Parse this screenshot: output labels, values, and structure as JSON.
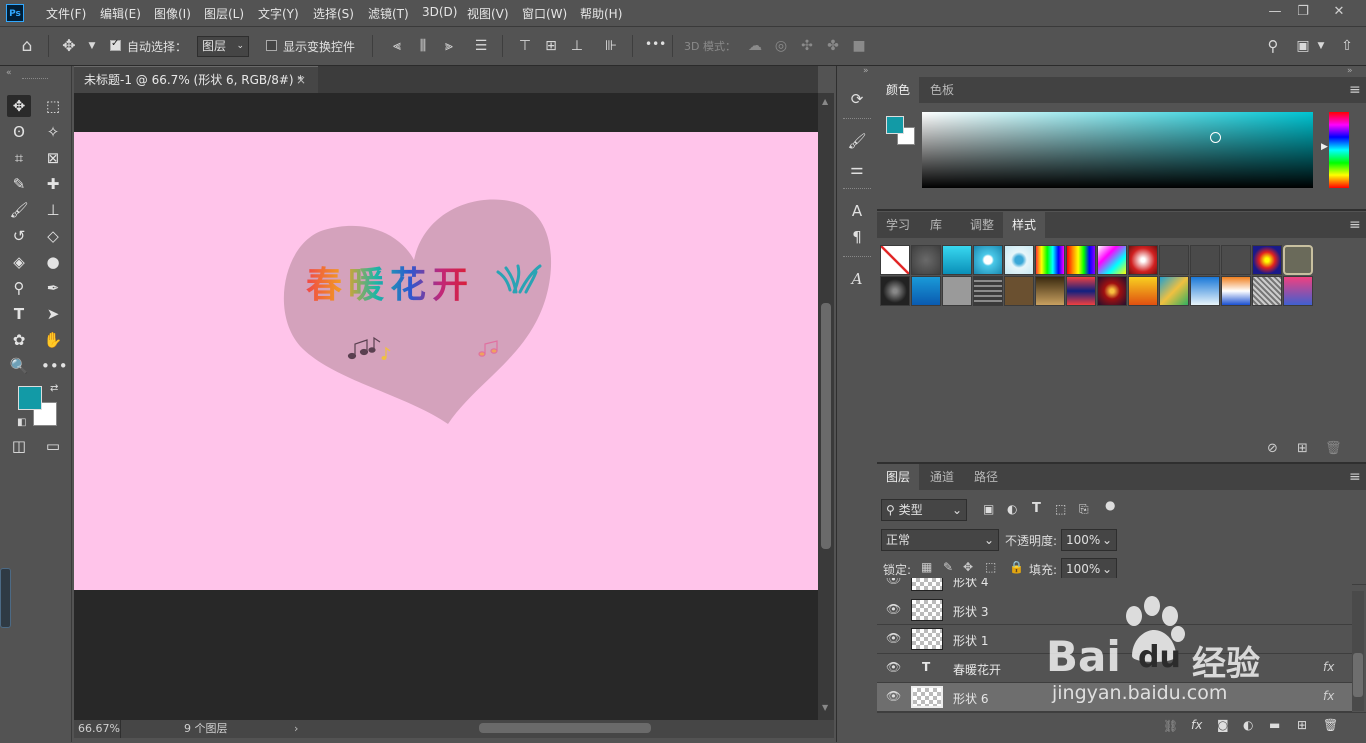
{
  "app": {
    "logo": "Ps"
  },
  "menu": [
    "文件(F)",
    "编辑(E)",
    "图像(I)",
    "图层(L)",
    "文字(Y)",
    "选择(S)",
    "滤镜(T)",
    "3D(D)",
    "视图(V)",
    "窗口(W)",
    "帮助(H)"
  ],
  "window_controls": {
    "minimize": "—",
    "restore": "❐",
    "close": "✕"
  },
  "options": {
    "auto_select_label": "自动选择：",
    "auto_select_checked": true,
    "auto_select_target": "图层",
    "show_transform_label": "显示变换控件",
    "show_transform_checked": false,
    "more": "•••",
    "mode_3d_label": "3D 模式："
  },
  "document": {
    "tab_title": "未标题-1 @ 66.7% (形状 6, RGB/8#) *",
    "tab_close": "×",
    "canvas_text": "春暖花开",
    "zoom": "66.67%",
    "layer_count": "9 个图层",
    "canvas_color": "#ffc4ea",
    "heart_color": "#d4a2bc"
  },
  "colors": {
    "foreground": "#129aa6",
    "background": "#ffffff"
  },
  "color_panel": {
    "tabs": [
      "颜色",
      "色板"
    ],
    "active": 0
  },
  "styles_panel": {
    "tabs": [
      "学习",
      "库",
      "调整",
      "样式"
    ],
    "active": 3
  },
  "layers_panel": {
    "tabs": [
      "图层",
      "通道",
      "路径"
    ],
    "active": 0,
    "filter_kind": "类型",
    "blend_mode": "正常",
    "opacity_label": "不透明度:",
    "opacity_value": "100%",
    "lock_label": "锁定:",
    "fill_label": "填充:",
    "fill_value": "100%",
    "layers": [
      {
        "name": "形状 4",
        "type": "shape",
        "fx": false,
        "selected": false,
        "partial": true
      },
      {
        "name": "形状 3",
        "type": "shape",
        "fx": false,
        "selected": false
      },
      {
        "name": "形状 1",
        "type": "shape",
        "fx": false,
        "selected": false
      },
      {
        "name": "春暖花开",
        "type": "text",
        "fx": true,
        "selected": false
      },
      {
        "name": "形状 6",
        "type": "shape",
        "fx": true,
        "selected": true
      }
    ]
  },
  "watermark": {
    "brand_a": "Bai",
    "brand_b": "du",
    "brand_c": "经验",
    "url": "jingyan.baidu.com"
  }
}
